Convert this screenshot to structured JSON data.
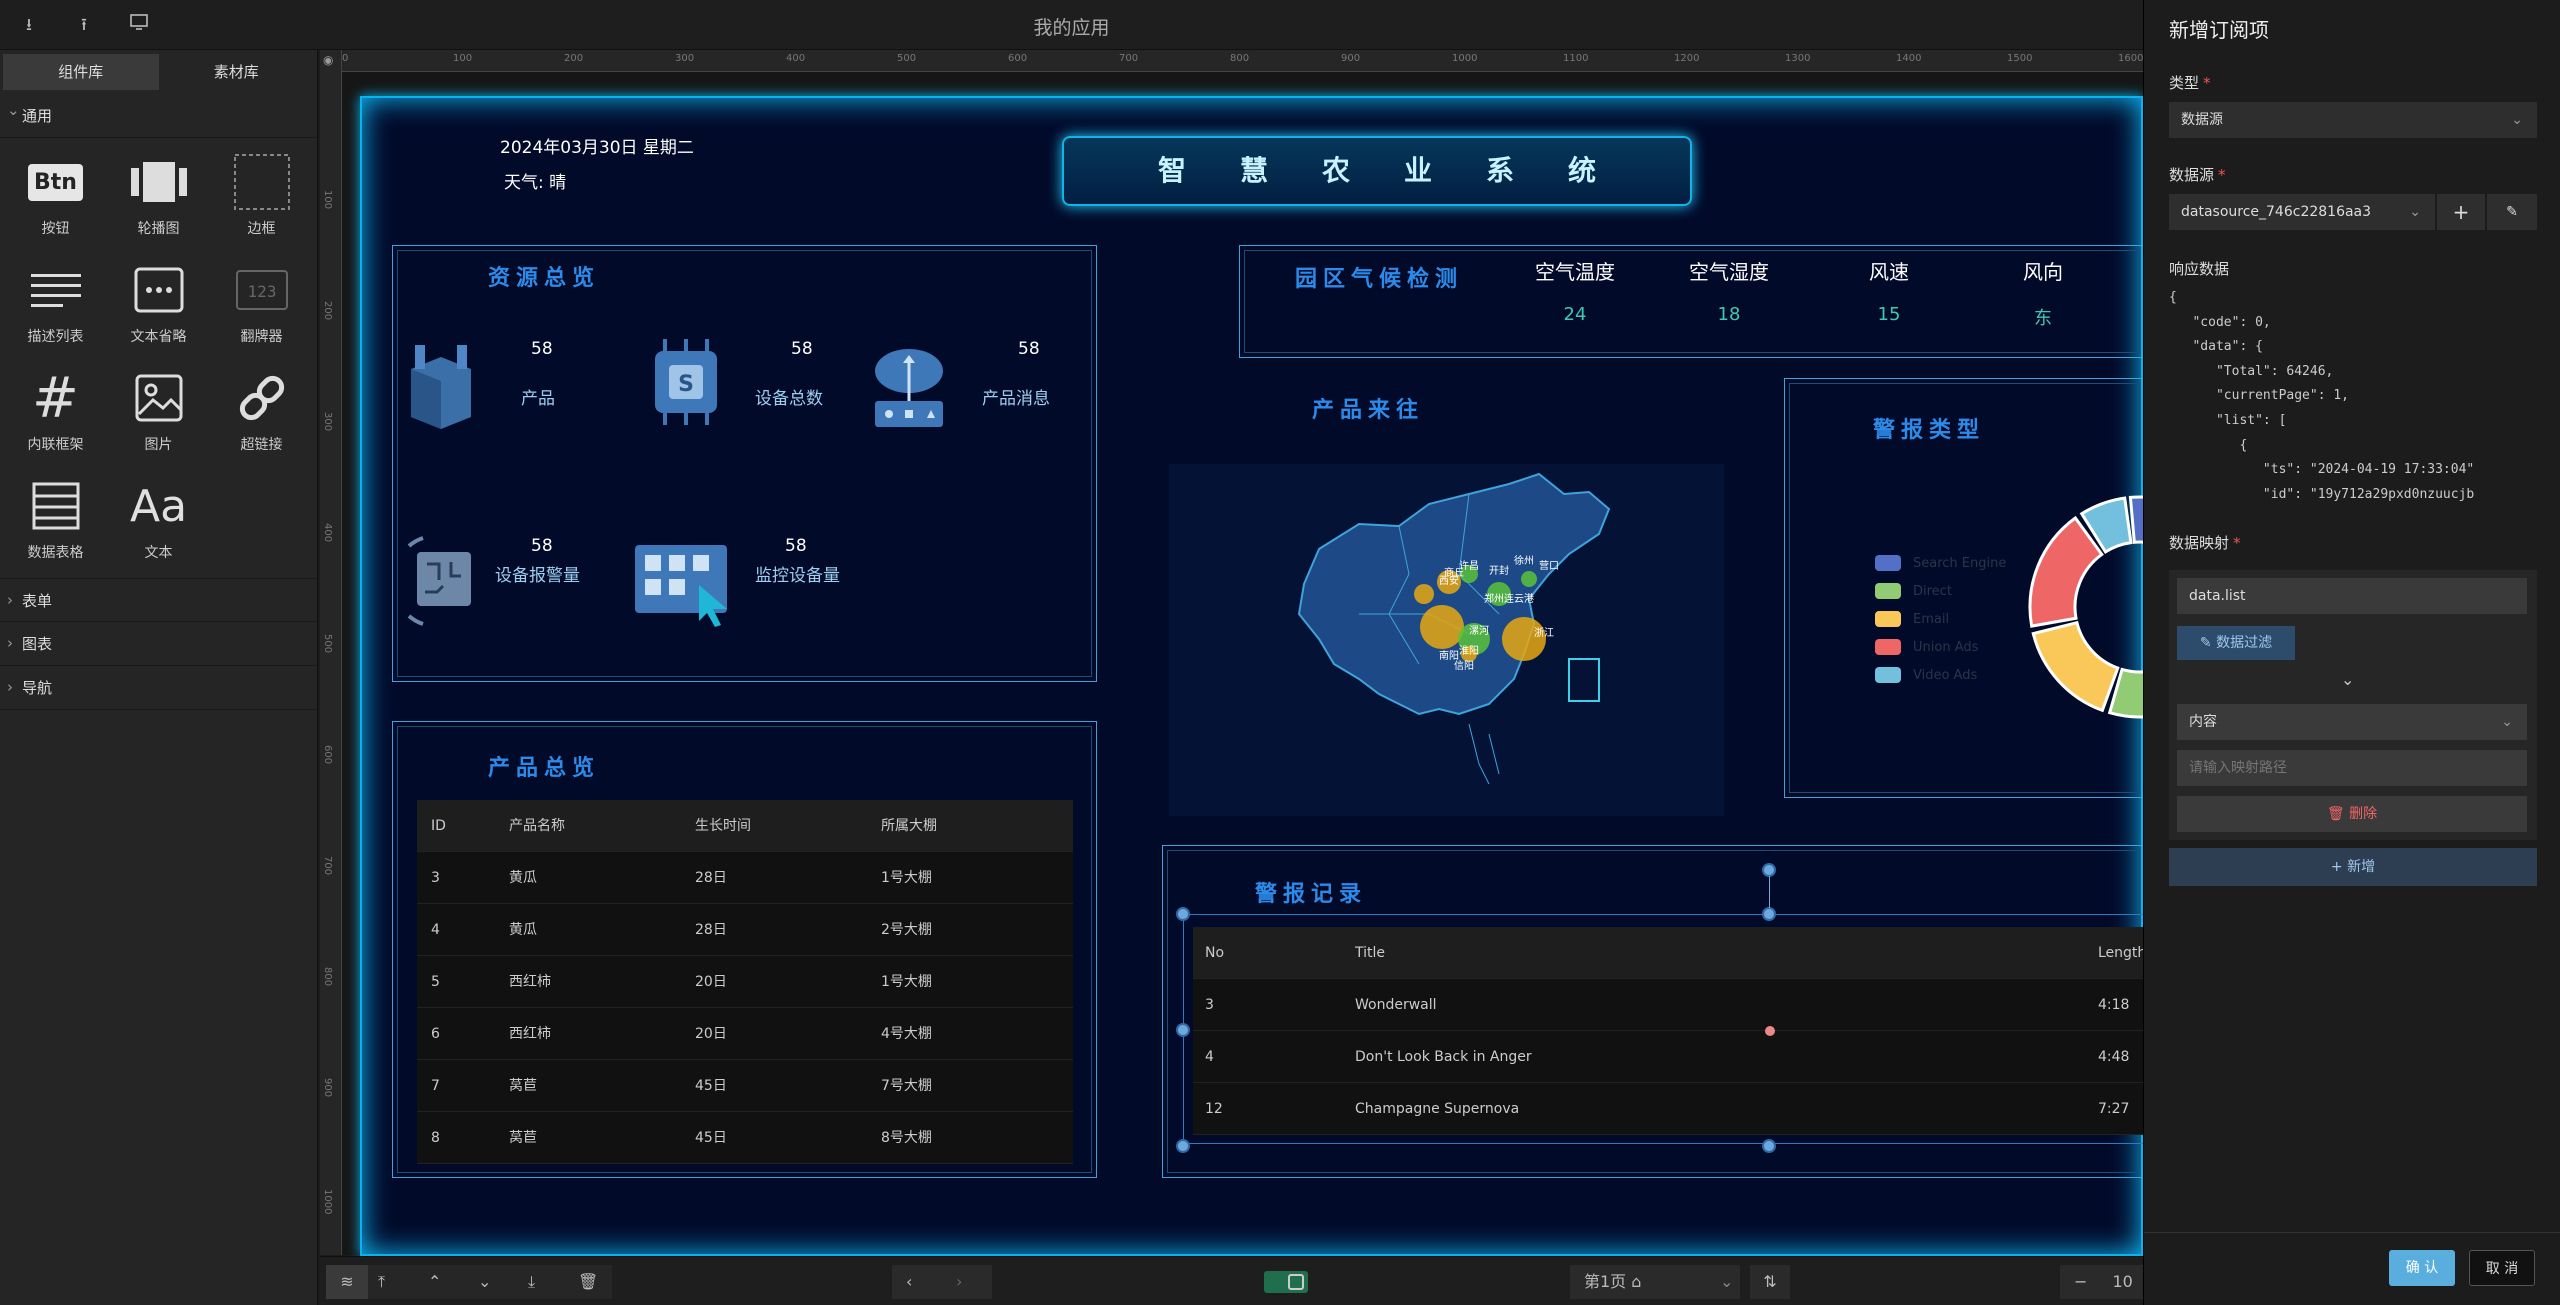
{
  "toolbar": {
    "title": "我的应用"
  },
  "left": {
    "tabs": [
      "组件库",
      "素材库"
    ],
    "groups": {
      "general": "通用",
      "form": "表单",
      "chart": "图表",
      "nav": "导航"
    },
    "components": [
      {
        "label": "按钮",
        "icon": "button-icon"
      },
      {
        "label": "轮播图",
        "icon": "carousel-icon"
      },
      {
        "label": "边框",
        "icon": "border-icon"
      },
      {
        "label": "描述列表",
        "icon": "description-list-icon"
      },
      {
        "label": "文本省略",
        "icon": "text-ellipsis-icon"
      },
      {
        "label": "翻牌器",
        "icon": "flip-counter-icon"
      },
      {
        "label": "内联框架",
        "icon": "iframe-icon"
      },
      {
        "label": "图片",
        "icon": "image-icon"
      },
      {
        "label": "超链接",
        "icon": "link-icon"
      },
      {
        "label": "数据表格",
        "icon": "table-icon"
      },
      {
        "label": "文本",
        "icon": "text-icon"
      }
    ],
    "btn_glyph": "Btn",
    "text_glyph": "Aa"
  },
  "ruler": [
    "0",
    "100",
    "200",
    "300",
    "400",
    "500",
    "600",
    "700",
    "800",
    "900",
    "1000",
    "1100",
    "1200",
    "1300",
    "1400",
    "1500",
    "1600"
  ],
  "ruler_v": [
    "100",
    "200",
    "300",
    "400",
    "500",
    "600",
    "700",
    "800",
    "900",
    "1000"
  ],
  "screen": {
    "date": "2024年03月30日 星期二",
    "weather": "天气: 晴",
    "system_title": "智慧农业系统",
    "resources": {
      "title": "资源总览",
      "items": [
        {
          "value": "58",
          "label": "产品"
        },
        {
          "value": "58",
          "label": "设备总数"
        },
        {
          "value": "58",
          "label": "产品消息"
        },
        {
          "value": "58",
          "label": "设备报警量"
        },
        {
          "value": "58",
          "label": "监控设备量"
        }
      ]
    },
    "products": {
      "title": "产品总览",
      "columns": [
        "ID",
        "产品名称",
        "生长时间",
        "所属大棚"
      ],
      "rows": [
        [
          "3",
          "黄瓜",
          "28日",
          "1号大棚"
        ],
        [
          "4",
          "黄瓜",
          "28日",
          "2号大棚"
        ],
        [
          "5",
          "西红柿",
          "20日",
          "1号大棚"
        ],
        [
          "6",
          "西红柿",
          "20日",
          "4号大棚"
        ],
        [
          "7",
          "莴苣",
          "45日",
          "7号大棚"
        ],
        [
          "8",
          "莴苣",
          "45日",
          "8号大棚"
        ]
      ]
    },
    "climate": {
      "title": "园区气候检测",
      "items": [
        {
          "label": "空气温度",
          "value": "24"
        },
        {
          "label": "空气湿度",
          "value": "18"
        },
        {
          "label": "风速",
          "value": "15"
        },
        {
          "label": "风向",
          "value": "东"
        }
      ]
    },
    "map": {
      "title": "产品来往",
      "cities": [
        "徐州",
        "许昌",
        "开封",
        "商丘",
        "连云港",
        "西安",
        "郑州",
        "漯河",
        "淮阳",
        "南阳",
        "浙江",
        "信阳",
        "营口"
      ]
    },
    "alarm_types": {
      "title": "警报类型",
      "legend": [
        {
          "name": "Search Engine",
          "color": "#5470c6"
        },
        {
          "name": "Direct",
          "color": "#91cc75"
        },
        {
          "name": "Email",
          "color": "#fac858"
        },
        {
          "name": "Union Ads",
          "color": "#ee6666"
        },
        {
          "name": "Video Ads",
          "color": "#73c0de"
        }
      ]
    },
    "alarms": {
      "title": "警报记录",
      "columns": [
        "No",
        "Title",
        "Length"
      ],
      "rows": [
        [
          "3",
          "Wonderwall",
          "4:18"
        ],
        [
          "4",
          "Don't Look Back in Anger",
          "4:48"
        ],
        [
          "12",
          "Champagne Supernova",
          "7:27"
        ]
      ]
    }
  },
  "bottom": {
    "page": "第1页",
    "zoom": "10"
  },
  "right": {
    "title": "新增订阅项",
    "type_label": "类型",
    "type_value": "数据源",
    "ds_label": "数据源",
    "ds_value": "datasource_746c22816aa3",
    "resp_label": "响应数据",
    "code": [
      {
        "t": "{"
      },
      {
        "t": "   \"code\": 0,"
      },
      {
        "t": "   \"data\": {"
      },
      {
        "t": "      \"Total\": 64246,"
      },
      {
        "t": "      \"currentPage\": 1,"
      },
      {
        "t": "      \"list\": ["
      },
      {
        "t": "         {"
      },
      {
        "t": "            \"ts\": \"2024-04-19 17:33:04\""
      },
      {
        "t": "            \"id\": \"19y712a29pxd0nzuucjb"
      }
    ],
    "map_label": "数据映射",
    "map_path": "data.list",
    "filter_label": "数据过滤",
    "content_value": "内容",
    "path_placeholder": "请输入映射路径",
    "delete_label": "删除",
    "add_label": "新增",
    "confirm_label": "确 认",
    "cancel_label": "取 消"
  }
}
